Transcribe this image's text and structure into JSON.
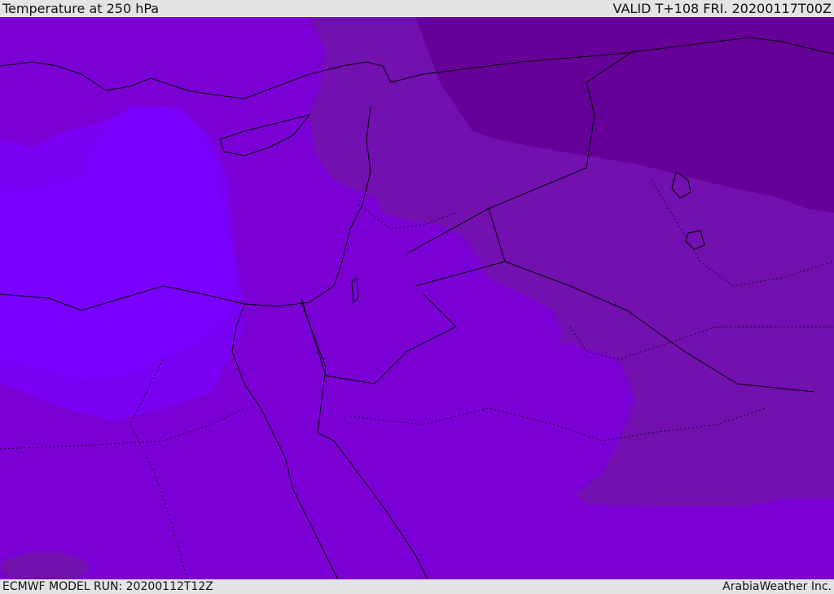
{
  "header": {
    "title": "Temperature at 250 hPa",
    "valid_time": "VALID T+108 FRI. 20200117T00Z"
  },
  "footer": {
    "model_run": "ECMWF MODEL RUN: 20200112T12Z",
    "provider": "ArabiaWeather Inc."
  },
  "map": {
    "field": "temperature-250hPa",
    "colors": {
      "coldest": "#650099",
      "cold": "#7210b0",
      "mid": "#7b00d6",
      "warm": "#7a00f4",
      "warmest": "#7a00ff",
      "sea_patch": "#7d00ea",
      "coastline": "#000000"
    }
  }
}
